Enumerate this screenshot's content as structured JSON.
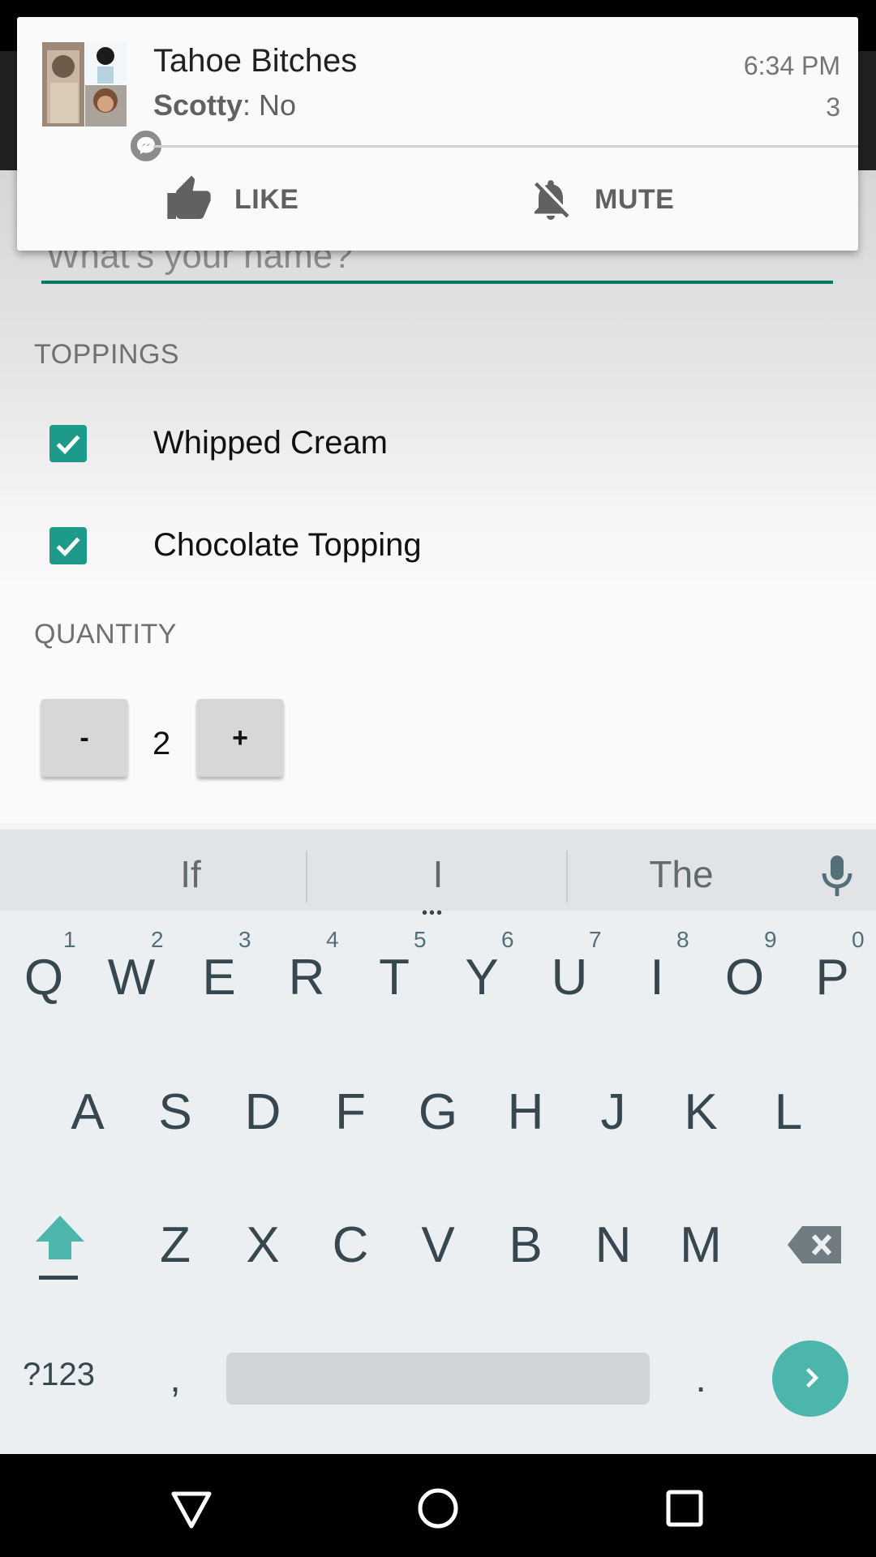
{
  "notification": {
    "title": "Tahoe Bitches",
    "sender": "Scotty",
    "message": ": No",
    "time": "6:34 PM",
    "count": "3",
    "actions": [
      {
        "label": "LIKE",
        "icon": "thumbs-up-icon"
      },
      {
        "label": "MUTE",
        "icon": "bell-off-icon"
      }
    ]
  },
  "form": {
    "name_placeholder": "What's your name?",
    "toppings_label": "TOPPINGS",
    "toppings": [
      {
        "label": "Whipped Cream",
        "checked": true
      },
      {
        "label": "Chocolate Topping",
        "checked": true
      }
    ],
    "quantity_label": "QUANTITY",
    "decrement_label": "-",
    "increment_label": "+",
    "quantity_value": "2"
  },
  "keyboard": {
    "suggestions": [
      "If",
      "I",
      "The"
    ],
    "row1": [
      "Q",
      "W",
      "E",
      "R",
      "T",
      "Y",
      "U",
      "I",
      "O",
      "P"
    ],
    "row1_hints": [
      "1",
      "2",
      "3",
      "4",
      "5",
      "6",
      "7",
      "8",
      "9",
      "0"
    ],
    "row2": [
      "A",
      "S",
      "D",
      "F",
      "G",
      "H",
      "J",
      "K",
      "L"
    ],
    "row3": [
      "Z",
      "X",
      "C",
      "V",
      "B",
      "N",
      "M"
    ],
    "symbols_label": "?123",
    "comma_label": ",",
    "period_label": "."
  },
  "colors": {
    "accent": "#00796b",
    "checkbox": "#1d9a8a",
    "enter_key": "#4db6ac"
  }
}
